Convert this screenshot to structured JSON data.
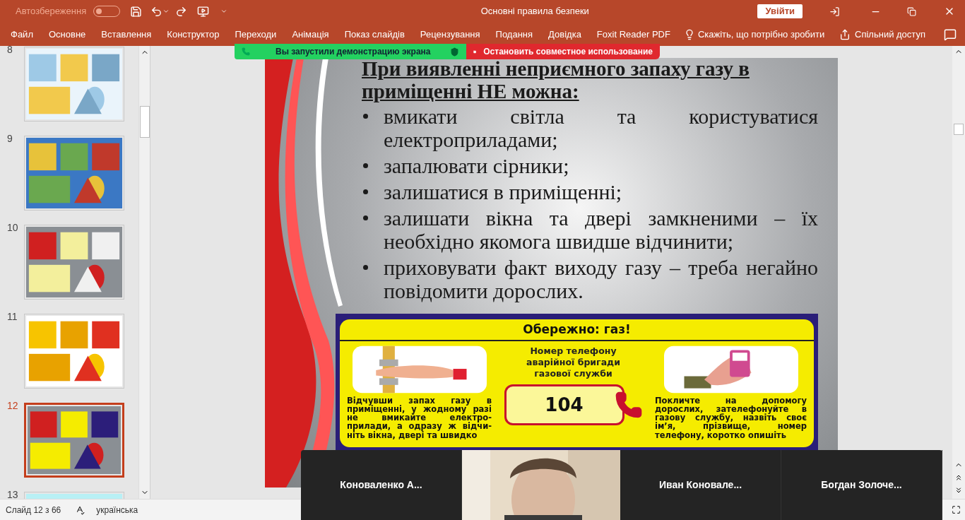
{
  "window": {
    "title": "Основні правила безпеки",
    "autosave_label": "Автозбереження",
    "autosave_on": false,
    "signin": "Увійти"
  },
  "ribbon": {
    "tabs": [
      {
        "label": "Файл",
        "selected": false
      },
      {
        "label": "Основне",
        "selected": false
      },
      {
        "label": "Вставлення",
        "selected": false
      },
      {
        "label": "Конструктор",
        "selected": false
      },
      {
        "label": "Переходи",
        "selected": false
      },
      {
        "label": "Анімація",
        "selected": false
      },
      {
        "label": "Показ слайдів",
        "selected": false
      },
      {
        "label": "Рецензування",
        "selected": false
      },
      {
        "label": "Подання",
        "selected": false
      },
      {
        "label": "Довідка",
        "selected": false
      },
      {
        "label": "Foxit Reader PDF",
        "selected": false
      }
    ],
    "tell_me": "Скажіть, що потрібно зробити",
    "share": "Спільний доступ"
  },
  "share_banner": {
    "status": "Вы запустили демонстрацию экрана",
    "stop": "Остановить совместное использование"
  },
  "thumbnails": [
    {
      "number": "8",
      "selected": false
    },
    {
      "number": "9",
      "selected": false
    },
    {
      "number": "10",
      "selected": false
    },
    {
      "number": "11",
      "selected": false
    },
    {
      "number": "12",
      "selected": true
    },
    {
      "number": "13",
      "selected": false
    }
  ],
  "slide": {
    "title": "При виявленні неприємного запаху газу в приміщенні НЕ можна:",
    "bullets": [
      "вмикати світла та користуватися електроприладами;",
      "запалювати сірники;",
      "залишатися в приміщенні;",
      "залишати вікна та двері замкненими – їх необхідно якомога швидше відчинити;",
      "приховувати факт виходу газу – треба негайно повідомити дорослих."
    ],
    "poster": {
      "heading": "Обережно: газ!",
      "phone_caption": "Номер телефону аварійної бригади газової служби",
      "phone": "104",
      "left_text": "Відчувши запах газу в приміщенні, у жодному разі не вмикайте електро-прилади, а одразу ж відчи-ніть вікна, двері та швидко",
      "right_text": "Покличте на допомогу дорослих, зателефонуйте в газову службу, назвіть своє ім’я, прізвище, номер телефону, коротко опишіть"
    }
  },
  "status_bar": {
    "slide": "Слайд 12 з 66",
    "language": "українська"
  },
  "participants": [
    {
      "kind": "name",
      "name": "Коноваленко А..."
    },
    {
      "kind": "video"
    },
    {
      "kind": "name",
      "name": "Иван Коновале..."
    },
    {
      "kind": "name",
      "name": "Богдан Золоче..."
    }
  ]
}
